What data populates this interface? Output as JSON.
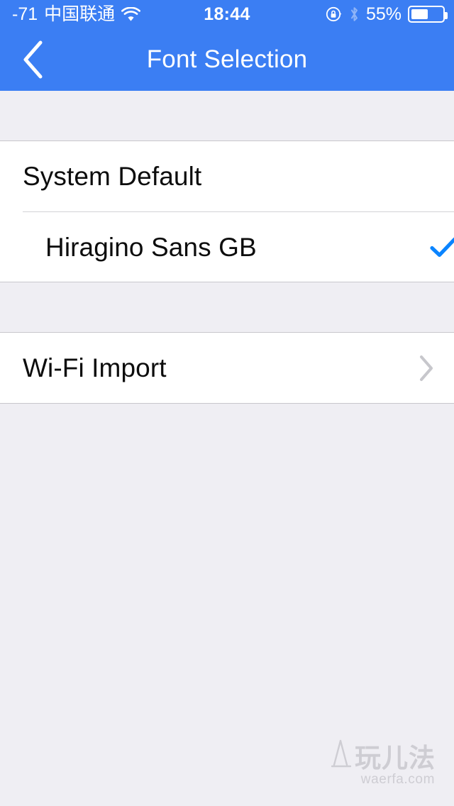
{
  "status_bar": {
    "rssi": "-71",
    "carrier": "中国联通",
    "wifi_icon": "wifi-icon",
    "time": "18:44",
    "rotation_lock_icon": "rotation-lock-icon",
    "bluetooth_icon": "bluetooth-icon",
    "battery_percent": "55%",
    "battery_level": 55,
    "background_color": "#3B7EF3",
    "text_color": "#FFFFFF"
  },
  "nav_bar": {
    "back_icon": "chevron-left-icon",
    "title": "Font Selection",
    "background_color": "#3B7EF3",
    "title_color": "#FFFFFF"
  },
  "sections": [
    {
      "name": "font-list",
      "rows": [
        {
          "label": "System Default",
          "accessory": "none",
          "selected": false
        },
        {
          "label": "Hiragino Sans GB",
          "accessory": "checkmark-icon",
          "selected": true
        }
      ]
    },
    {
      "name": "import",
      "rows": [
        {
          "label": "Wi-Fi Import",
          "accessory": "chevron-right-icon",
          "selected": false
        }
      ]
    }
  ],
  "colors": {
    "accent": "#0A84FF",
    "background": "#EFEEF3",
    "cell": "#FFFFFF",
    "separator": "#D3D3D6",
    "section_border": "#C8C7CC",
    "label": "#0D0D0D",
    "chevron_gray": "#C7C7CC",
    "watermark": "#CECDD3"
  },
  "watermark": {
    "brand_cn": "玩儿法",
    "url": "waerfa.com"
  }
}
